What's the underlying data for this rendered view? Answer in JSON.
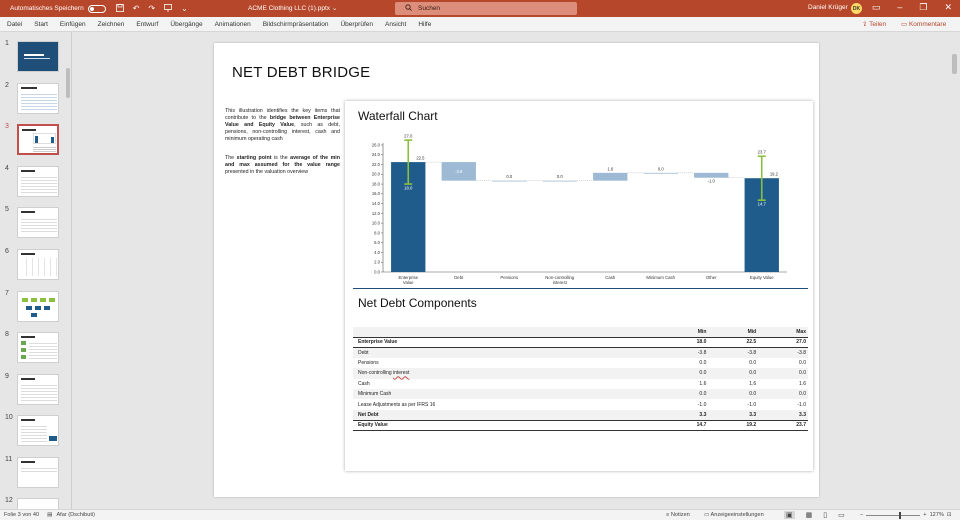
{
  "titlebar": {
    "autosave_label": "Automatisches Speichern",
    "filename": "ACME Clothing LLC (1).pptx",
    "filename_chevron": "⌄",
    "search_placeholder": "Suchen",
    "user_name": "Daniel Krüger",
    "user_initials": "DK",
    "icons": [
      "save-icon",
      "undo-icon",
      "redo-icon",
      "present-icon",
      "customize-icon"
    ],
    "window_buttons": [
      "ribbon-display-icon",
      "minimize-icon",
      "restore-icon",
      "close-icon"
    ]
  },
  "ribbon": {
    "tabs": [
      "Datei",
      "Start",
      "Einfügen",
      "Zeichnen",
      "Entwurf",
      "Übergänge",
      "Animationen",
      "Bildschirmpräsentation",
      "Überprüfen",
      "Ansicht",
      "Hilfe"
    ],
    "share_label": "Teilen",
    "comments_label": "Kommentare",
    "accent": "#b7472a"
  },
  "thumbnails": {
    "numbers": [
      "1",
      "2",
      "3",
      "4",
      "5",
      "6",
      "7",
      "8",
      "9",
      "10",
      "11",
      "12"
    ],
    "active_index": 3
  },
  "slide": {
    "title": "NET DEBT BRIDGE",
    "paragraph1_a": "This illustration identifies the key items that contribute to the ",
    "paragraph1_b": "bridge between Enterprise Value and Equity Value",
    "paragraph1_c": ", such as debt, pensions, non-controlling interest, cash and minimum operating cash",
    "paragraph2_a": "The ",
    "paragraph2_b": "starting point",
    "paragraph2_c": " is the ",
    "paragraph2_d": "average of the min and max assumed for the value range",
    "paragraph2_e": " presented in the valuation overview",
    "chart_title": "Waterfall Chart",
    "table_title": "Net Debt Components"
  },
  "chart_data": {
    "type": "bar",
    "subtype": "waterfall",
    "title": "Waterfall Chart",
    "categories": [
      "Enterprise Value",
      "Debt",
      "Pensions",
      "Non-controlling interest",
      "Cash",
      "Minimum Cash",
      "Other",
      "Equity Value"
    ],
    "values": [
      22.5,
      -3.8,
      0.0,
      0.0,
      1.6,
      0.0,
      -1.0,
      19.2
    ],
    "value_labels": [
      "22.5",
      "-3.8",
      "0.0",
      "0.0",
      "1.6",
      "0.0",
      "-1.0",
      "19.2"
    ],
    "range_bars": [
      {
        "category": "Enterprise Value",
        "min": 18.0,
        "max": 27.0,
        "min_label": "18.0",
        "max_label": "27.0"
      },
      {
        "category": "Equity Value",
        "min": 14.7,
        "max": 23.7,
        "min_label": "14.7",
        "max_label": "23.7"
      }
    ],
    "ylim": [
      0,
      26
    ],
    "yticks": [
      "0.0",
      "2.0",
      "4.0",
      "6.0",
      "8.0",
      "10.0",
      "12.0",
      "14.0",
      "16.0",
      "18.0",
      "20.0",
      "22.0",
      "24.0",
      "26.0"
    ],
    "colors": {
      "total": "#1f5c8b",
      "delta": "#9db9d3",
      "range": "#8cbf3f"
    },
    "xlabel": "",
    "ylabel": ""
  },
  "table": {
    "headers": [
      "",
      "Min",
      "Mid",
      "Max"
    ],
    "rows": [
      {
        "label": "Enterprise Value",
        "min": "18.0",
        "mid": "22.5",
        "max": "27.0",
        "style": "bold"
      },
      {
        "label": "Debt",
        "min": "-3.8",
        "mid": "-3.8",
        "max": "-3.8",
        "style": "shade"
      },
      {
        "label": "Pensions",
        "min": "0.0",
        "mid": "0.0",
        "max": "0.0",
        "style": ""
      },
      {
        "label": "Non-controlling interest",
        "min": "0.0",
        "mid": "0.0",
        "max": "0.0",
        "style": "shade"
      },
      {
        "label": "Cash",
        "min": "1.6",
        "mid": "1.6",
        "max": "1.6",
        "style": ""
      },
      {
        "label": "Minimum Cash",
        "min": "0.0",
        "mid": "0.0",
        "max": "0.0",
        "style": "shade"
      },
      {
        "label": "Lease Adjustments as per IFRS 16",
        "min": "-1.0",
        "mid": "-1.0",
        "max": "-1.0",
        "style": ""
      },
      {
        "label": "Net Debt",
        "min": "3.3",
        "mid": "3.3",
        "max": "3.3",
        "style": "bold-shade"
      },
      {
        "label": "Equity Value",
        "min": "14.7",
        "mid": "19.2",
        "max": "23.7",
        "style": "bold-final"
      }
    ]
  },
  "statusbar": {
    "slide_info": "Folie 3 von 40",
    "language": "Afar (Dschibuti)",
    "notes_label": "Notizen",
    "display_label": "Anzeigeeinstellungen",
    "zoom": "127%",
    "zoom_fraction": 0.6
  }
}
